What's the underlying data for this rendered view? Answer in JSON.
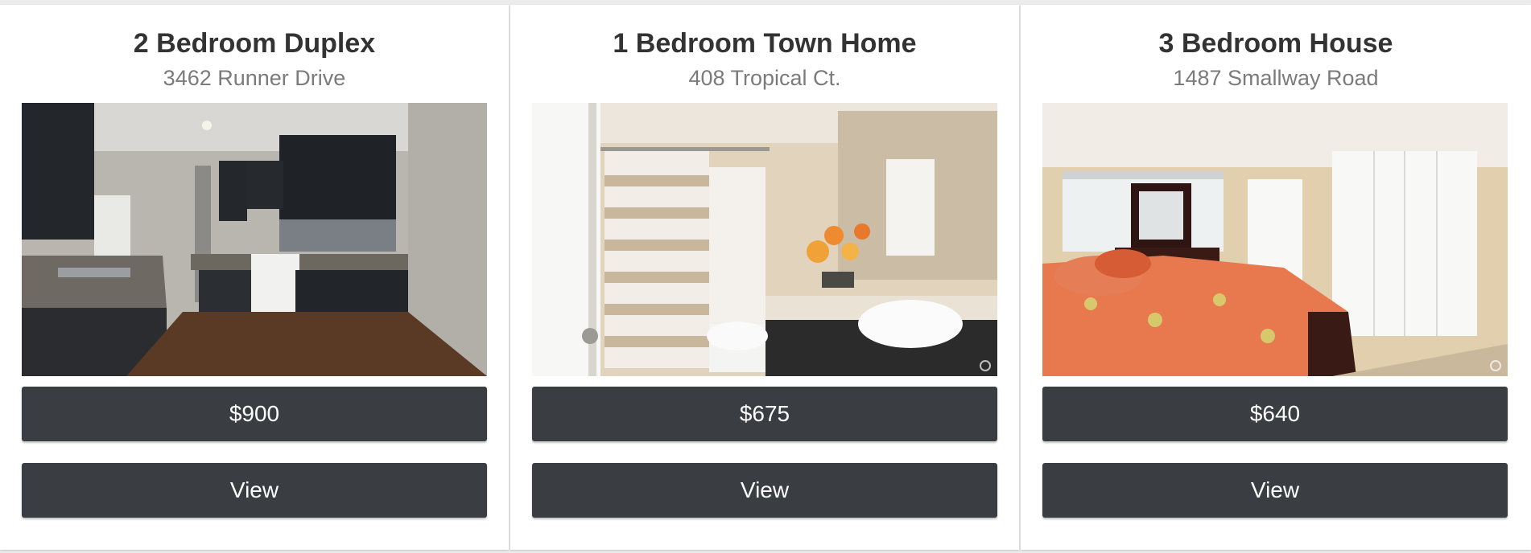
{
  "listings": [
    {
      "title": "2 Bedroom Duplex",
      "address": "3462 Runner Drive",
      "photo_subject": "kitchen",
      "price": "$900",
      "view_label": "View"
    },
    {
      "title": "1 Bedroom Town Home",
      "address": "408 Tropical Ct.",
      "photo_subject": "bathroom",
      "price": "$675",
      "view_label": "View"
    },
    {
      "title": "3 Bedroom House",
      "address": "1487 Smallway Road",
      "photo_subject": "bedroom",
      "price": "$640",
      "view_label": "View"
    }
  ],
  "colors": {
    "button_bg": "#3a3d42",
    "button_text": "#ffffff",
    "title_text": "#333333",
    "address_text": "#7b7b7b",
    "card_bg": "#ffffff",
    "page_bg": "#ececec"
  }
}
